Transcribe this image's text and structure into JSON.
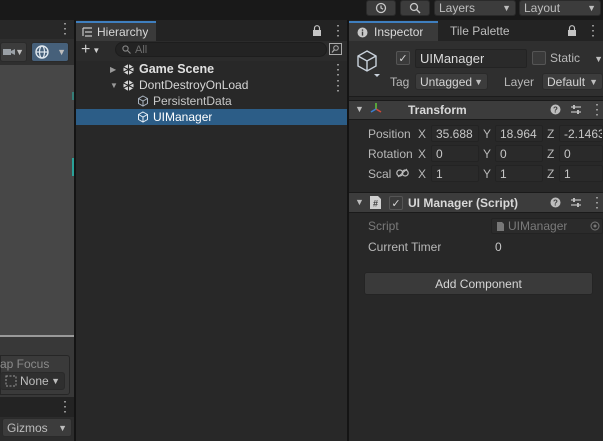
{
  "toolbar": {
    "layers_label": "Layers",
    "layout_label": "Layout"
  },
  "scene_view": {
    "snap_focus_label": "ap Focus",
    "none_label": "None",
    "gizmos_label": "Gizmos"
  },
  "hierarchy": {
    "tab_label": "Hierarchy",
    "search_placeholder": "All",
    "items": [
      {
        "label": "Game Scene"
      },
      {
        "label": "DontDestroyOnLoad"
      },
      {
        "label": "PersistentData"
      },
      {
        "label": "UIManager"
      }
    ]
  },
  "inspector": {
    "tab_label": "Inspector",
    "tile_palette_label": "Tile Palette",
    "object_name": "UIManager",
    "static_label": "Static",
    "tag_label": "Tag",
    "tag_value": "Untagged",
    "layer_label": "Layer",
    "layer_value": "Default",
    "transform": {
      "title": "Transform",
      "position_label": "Position",
      "rotation_label": "Rotation",
      "scale_label": "Scal",
      "x": "X",
      "y": "Y",
      "z": "Z",
      "position": [
        "35.688",
        "18.964",
        "-2.1463"
      ],
      "rotation": [
        "0",
        "0",
        "0"
      ],
      "scale": [
        "1",
        "1",
        "1"
      ]
    },
    "script_component": {
      "title": "UI Manager (Script)",
      "script_label": "Script",
      "script_value": "UIManager",
      "timer_label": "Current Timer",
      "timer_value": "0"
    },
    "add_component_label": "Add Component"
  },
  "colors": {
    "selection": "#2c5d87",
    "panel_bg": "#282828",
    "header_bg": "#3c3c3c"
  }
}
